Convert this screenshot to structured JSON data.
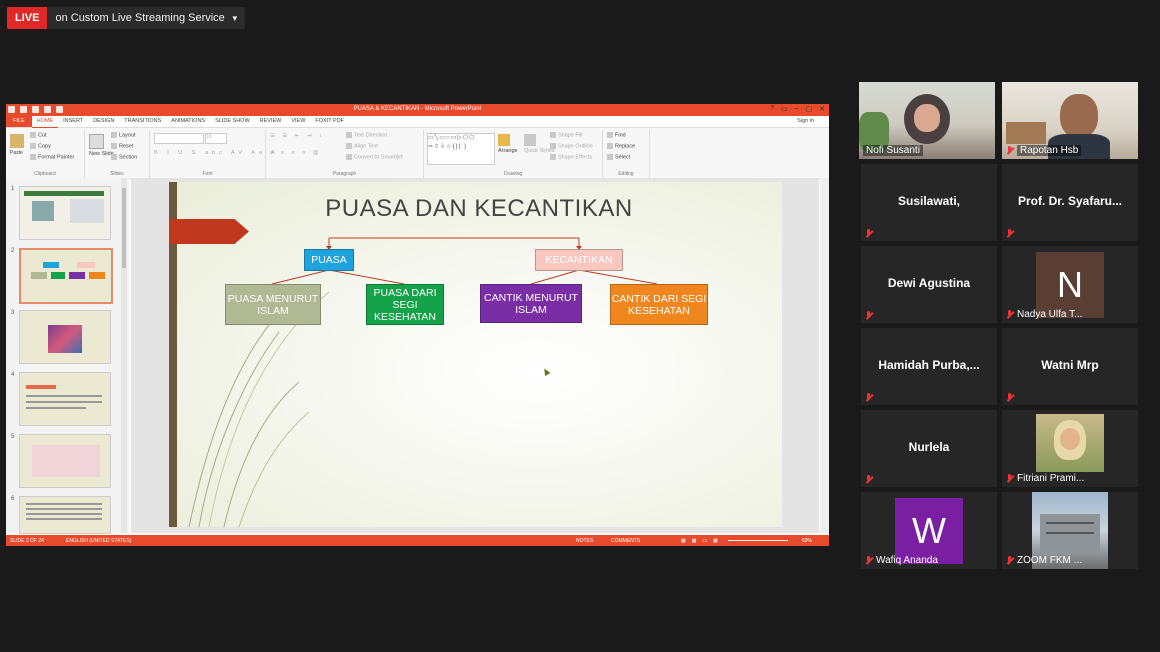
{
  "live": {
    "badge": "LIVE",
    "text": "on Custom Live Streaming Service",
    "caret": "▼"
  },
  "ppt": {
    "window_title": "PUASA & KECANTIKAN - Microsoft PowerPoint",
    "window_controls": [
      "?",
      "▭",
      "–",
      "▢",
      "✕"
    ],
    "tabs": [
      "FILE",
      "HOME",
      "INSERT",
      "DESIGN",
      "TRANSITIONS",
      "ANIMATIONS",
      "SLIDE SHOW",
      "REVIEW",
      "VIEW",
      "FOXIT PDF"
    ],
    "sign_in": "Sign in",
    "ribbon": {
      "paste": "Paste",
      "cut": "Cut",
      "copy": "Copy",
      "format_painter": "Format Painter",
      "clipboard": "Clipboard",
      "new_slide": "New Slide",
      "layout": "Layout",
      "reset": "Reset",
      "section": "Section",
      "slides": "Slides",
      "font": "Font",
      "font_size": "18",
      "text_direction": "Text Direction",
      "align_text": "Align Text",
      "convert_smartart": "Convert to SmartArt",
      "paragraph": "Paragraph",
      "arrange": "Arrange",
      "quick_styles": "Quick Styles",
      "shape_fill": "Shape Fill",
      "shape_outline": "Shape Outline",
      "shape_effects": "Shape Effects",
      "drawing": "Drawing",
      "find": "Find",
      "replace": "Replace",
      "select": "Select",
      "editing": "Editing"
    },
    "slide_numbers": [
      "1",
      "2",
      "3",
      "4",
      "5",
      "6"
    ],
    "slide": {
      "title": "PUASA DAN KECANTIKAN",
      "boxes": {
        "puasa": "PUASA",
        "kecantikan": "KECANTIKAN",
        "puasa_islam": "PUASA MENURUT ISLAM",
        "puasa_kesehatan": "PUASA DARI SEGI KESEHATAN",
        "cantik_islam": "CANTIK MENURUT ISLAM",
        "cantik_kesehatan": "CANTIK DARI SEGI KESEHATAN"
      },
      "colors": {
        "puasa": "#1ea3dd",
        "kecantikan": "#f7c7c0",
        "puasa_islam": "#b1b894",
        "puasa_kesehatan": "#15a349",
        "cantik_islam": "#7a2ea6",
        "cantik_kesehatan": "#f0871e"
      }
    },
    "status": {
      "slide": "SLIDE 2 OF 24",
      "language": "ENGLISH (UNITED STATES)",
      "notes": "NOTES",
      "comments": "COMMENTS",
      "zoom": "69%"
    }
  },
  "participants": [
    {
      "name": "Nofi Susanti",
      "video": true
    },
    {
      "name": "Rapotan Hsb",
      "video": true
    },
    {
      "name": "Susilawati,"
    },
    {
      "name": "Prof. Dr. Syafaru..."
    },
    {
      "name": "Dewi Agustina"
    },
    {
      "name": "Nadya Ulfa T...",
      "avatar_letter": "N",
      "avatar_color": "#5a3e34"
    },
    {
      "name": "Hamidah Purba,..."
    },
    {
      "name": "Watni Mrp"
    },
    {
      "name": "Nurlela"
    },
    {
      "name": "Fitriani Prami...",
      "photo": true
    },
    {
      "name": "Wafiq Ananda",
      "avatar_letter": "W",
      "avatar_color": "#7b1fa2"
    },
    {
      "name": "ZOOM FKM ...",
      "photo": true
    }
  ]
}
